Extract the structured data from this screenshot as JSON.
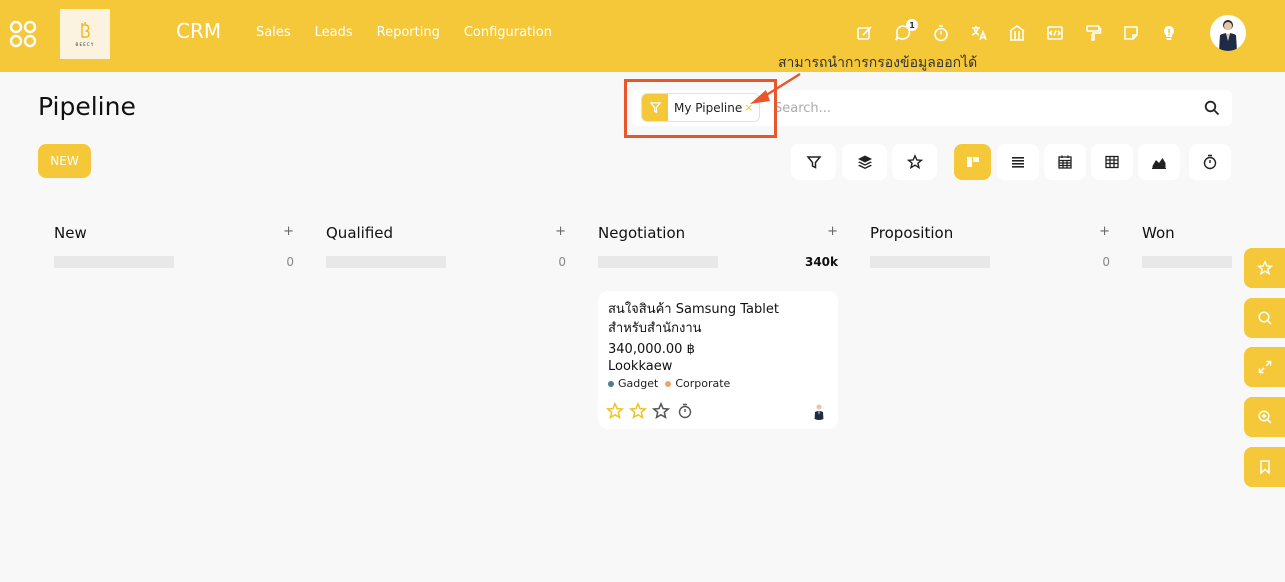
{
  "navbar": {
    "brand": "CRM",
    "logo_text": "BEECY",
    "menu": [
      "Sales",
      "Leads",
      "Reporting",
      "Configuration"
    ],
    "icons": [
      "edit-icon",
      "chat-icon",
      "timer-icon",
      "translate-icon",
      "bank-icon",
      "code-icon",
      "paint-roller-icon",
      "sticky-note-icon",
      "lightbulb-icon"
    ],
    "chat_badge": "1",
    "accent_color": "#f5c83a"
  },
  "control": {
    "title": "Pipeline",
    "new_label": "NEW",
    "search_placeholder": "Search...",
    "facet_label": "My Pipeline",
    "facet_remove": "×"
  },
  "annotation": {
    "text": "สามารถนำการกรองข้อมูลออกได้",
    "color": "#e8562a"
  },
  "columns": [
    {
      "title": "New",
      "total": "0",
      "add": "+"
    },
    {
      "title": "Qualified",
      "total": "0",
      "add": "+"
    },
    {
      "title": "Negotiation",
      "total": "340k",
      "add": "+"
    },
    {
      "title": "Proposition",
      "total": "0",
      "add": "+"
    },
    {
      "title": "Won",
      "total": "",
      "add": ""
    }
  ],
  "card": {
    "title": "สนใจสินค้า Samsung Tablet สำหรับสำนักงาน",
    "amount": "340,000.00 ฿",
    "customer": "Lookkaew",
    "tags": [
      {
        "label": "Gadget",
        "color": "#4a7f86"
      },
      {
        "label": "Corporate",
        "color": "#f0a46a"
      }
    ],
    "priority_stars": 3,
    "priority_filled": 2
  }
}
